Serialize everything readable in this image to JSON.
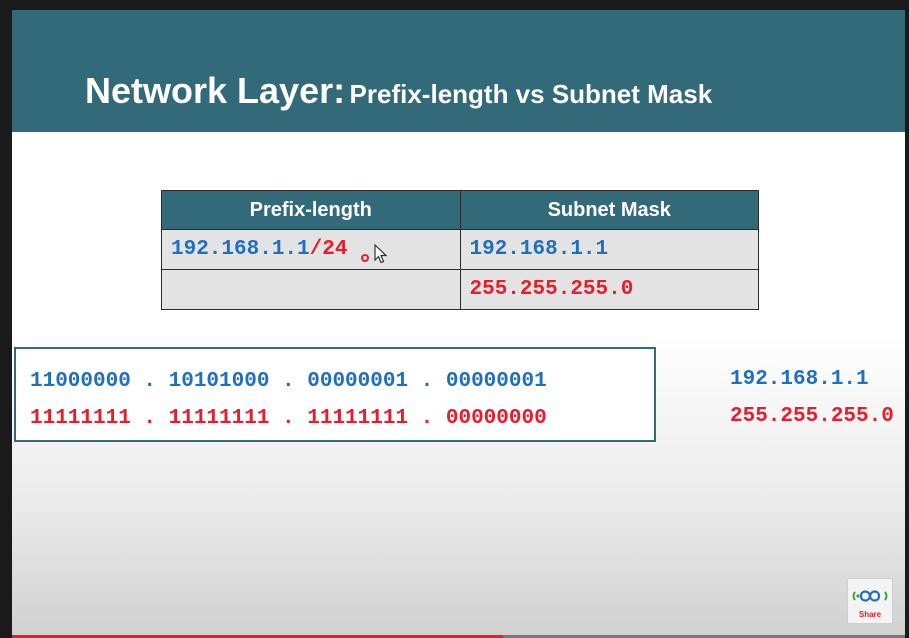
{
  "title": {
    "main": "Network Layer:",
    "sub": "Prefix-length vs Subnet Mask"
  },
  "table": {
    "headers": [
      "Prefix-length",
      "Subnet Mask"
    ],
    "prefix": {
      "ip": "192.168.1.1",
      "slash": "/24"
    },
    "mask_ip": "192.168.1.1",
    "mask_value": "255.255.255.0"
  },
  "binary": {
    "ip_row": "11000000 . 10101000 . 00000001 . 00000001",
    "mask_row": "11111111 . 11111111 . 11111111 . 00000000",
    "ip_decimal": "192.168.1.1",
    "mask_decimal": "255.255.255.0"
  },
  "logo": {
    "text": "Share",
    "icon": "infinity-share-icon"
  },
  "video": {
    "progress_fraction": 0.55
  },
  "colors": {
    "header": "#336a7a",
    "blue": "#1f6fbf",
    "red": "#e81c2b"
  }
}
